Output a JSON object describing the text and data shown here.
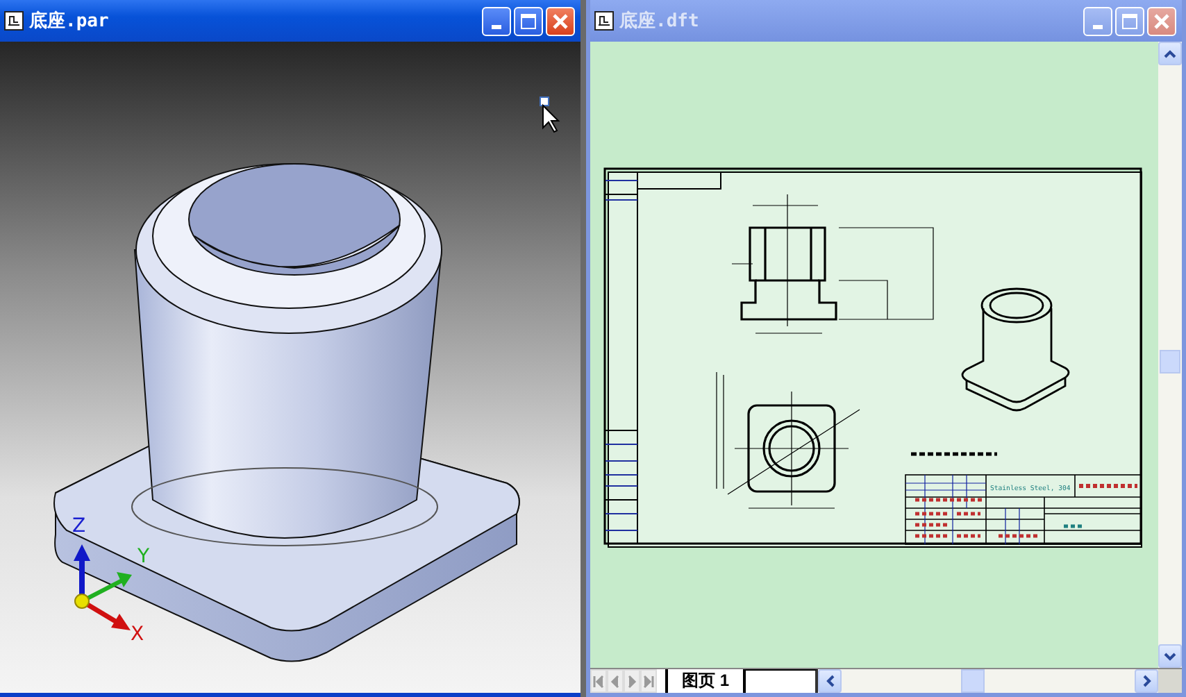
{
  "windows": [
    {
      "kind": "model",
      "title": "底座.par",
      "active": true,
      "axes": {
        "z": "Z",
        "y": "Y",
        "x": "X"
      }
    },
    {
      "kind": "drawing",
      "title": "底座.dft",
      "active": false,
      "title_block": {
        "material": "Stainless Steel, 304"
      },
      "sheet_tabs": [
        {
          "label": "图页 1",
          "selected": true
        }
      ]
    }
  ]
}
